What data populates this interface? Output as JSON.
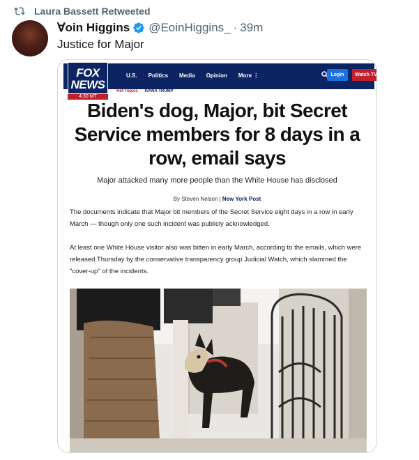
{
  "retweet": {
    "label": "Laura Bassett Retweeted"
  },
  "tweet": {
    "name": "Ɐoin Higgins",
    "handle": "@EoinHiggins_",
    "dot": "·",
    "time": "39m",
    "text": "Justice for Major"
  },
  "article": {
    "logo_line1": "FOX",
    "logo_line2": "NEWS",
    "clock": "4:30 MT",
    "nav": [
      "U.S.",
      "Politics",
      "Media",
      "Opinion",
      "More ⋮"
    ],
    "login": "Login",
    "watch": "Watch TV",
    "hot_topics_label": "Hot Topics",
    "hot_topic": "IVANA TRUMP",
    "headline": "Biden's dog, Major, bit Secret Service members for 8 days in a row, email says",
    "subhead": "Major attacked many more people than the White House has disclosed",
    "byline_prefix": "By Steven Nelson | ",
    "byline_source": "New York Post",
    "p1": "The documents indicate that Major bit members of the Secret Service eight days in a row in early March — though only one such incident was publicly acknowledged.",
    "p2": "At least one White House visitor also was bitten in early March, according to the emails, which were released Thursday by the conservative transparency group Judicial Watch, which slammed the \"cover-up\" of the incidents."
  },
  "colors": {
    "fox_navy": "#0d2463",
    "fox_red": "#c0212d",
    "twitter_gray": "#536471",
    "verified_blue": "#1d9bf0"
  }
}
